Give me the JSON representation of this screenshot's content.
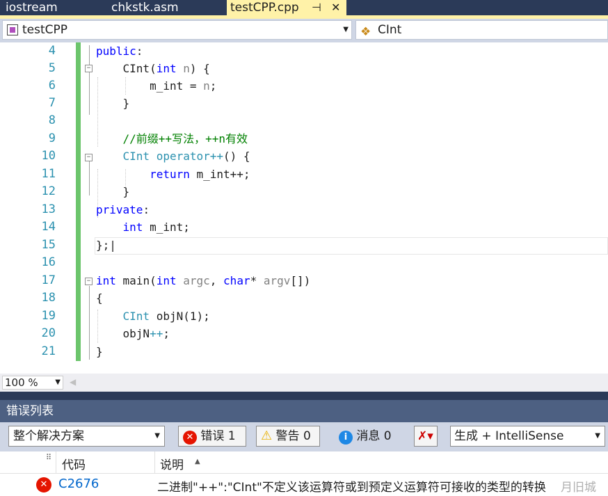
{
  "tabs": [
    {
      "label": "iostream"
    },
    {
      "label": "chkstk.asm"
    },
    {
      "label": "testCPP.cpp",
      "pin": "⊣",
      "close": "✕"
    }
  ],
  "nav": {
    "project": "testCPP",
    "member": "CInt"
  },
  "lines": [
    "4",
    "5",
    "6",
    "7",
    "8",
    "9",
    "10",
    "11",
    "12",
    "13",
    "14",
    "15",
    "16",
    "17",
    "18",
    "19",
    "20",
    "21"
  ],
  "zoom": "100 %",
  "errorlist": {
    "title": "错误列表",
    "scope": "整个解决方案",
    "errors_label": "错误 1",
    "warnings_label": "警告 0",
    "messages_label": "消息 0",
    "source": "生成 + IntelliSense",
    "col_code": "代码",
    "col_desc": "说明",
    "row_code": "C2676",
    "row_desc": "二进制\"++\":\"CInt\"不定义该运算符或到预定义运算符可接收的类型的转换",
    "watermark": "月旧城"
  },
  "colors": {
    "keyword": "#0000ff",
    "type": "#2b91af",
    "comment": "#008000",
    "active_tab": "#fff2a8",
    "error": "#e51400"
  }
}
